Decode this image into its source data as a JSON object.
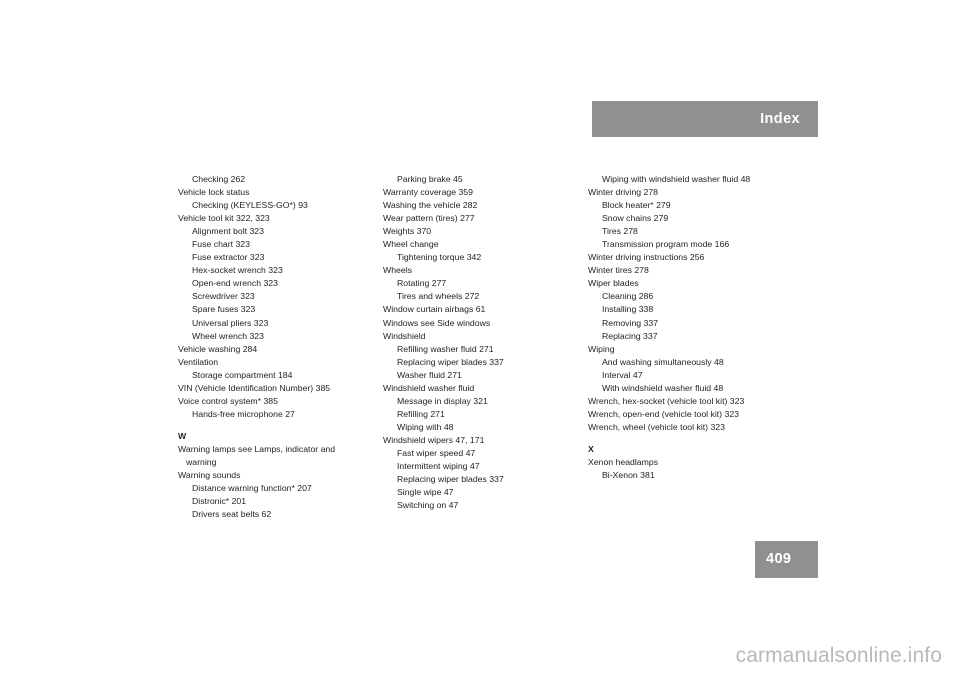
{
  "header": {
    "title": "Index"
  },
  "footer": {
    "page_number": "409",
    "watermark": "carmanualsonline.info"
  },
  "colors": {
    "band_gray": "#909090",
    "text": "#231f20",
    "watermark_gray": "#b9b9b9",
    "page_background": "#ffffff"
  },
  "columns": [
    {
      "id": "column-1",
      "entries": [
        {
          "text": "Checking 262",
          "level": 1
        },
        {
          "text": "Vehicle lock status",
          "level": 0
        },
        {
          "text": "Checking (KEYLESS-GO*) 93",
          "level": 1
        },
        {
          "text": "Vehicle tool kit 322, 323",
          "level": 0
        },
        {
          "text": "Alignment bolt 323",
          "level": 1
        },
        {
          "text": "Fuse chart 323",
          "level": 1
        },
        {
          "text": "Fuse extractor 323",
          "level": 1
        },
        {
          "text": "Hex-socket wrench 323",
          "level": 1
        },
        {
          "text": "Open-end wrench 323",
          "level": 1
        },
        {
          "text": "Screwdriver 323",
          "level": 1
        },
        {
          "text": "Spare fuses 323",
          "level": 1
        },
        {
          "text": "Universal pliers 323",
          "level": 1
        },
        {
          "text": "Wheel wrench 323",
          "level": 1
        },
        {
          "text": "Vehicle washing 284",
          "level": 0
        },
        {
          "text": "Ventilation",
          "level": 0
        },
        {
          "text": "Storage compartment 184",
          "level": 1
        },
        {
          "text": "VIN (Vehicle Identification Number) 385",
          "level": 0
        },
        {
          "text": "Voice control system* 385",
          "level": 0
        },
        {
          "text": "Hands-free microphone 27",
          "level": 1
        },
        {
          "text": "W",
          "level": "heading"
        },
        {
          "text": "Warning lamps see Lamps, indicator and",
          "level": 0
        },
        {
          "text": "warning",
          "level": "cont"
        },
        {
          "text": "Warning sounds",
          "level": 0
        },
        {
          "text": "Distance warning function* 207",
          "level": 1
        },
        {
          "text": "Distronic* 201",
          "level": 1
        },
        {
          "text": "Drivers seat belts 62",
          "level": 1
        }
      ]
    },
    {
      "id": "column-2",
      "entries": [
        {
          "text": "Parking brake 45",
          "level": 1
        },
        {
          "text": "Warranty coverage 359",
          "level": 0
        },
        {
          "text": "Washing the vehicle 282",
          "level": 0
        },
        {
          "text": "Wear pattern (tires) 277",
          "level": 0
        },
        {
          "text": "Weights 370",
          "level": 0
        },
        {
          "text": "Wheel change",
          "level": 0
        },
        {
          "text": "Tightening torque 342",
          "level": 1
        },
        {
          "text": "Wheels",
          "level": 0
        },
        {
          "text": "Rotating 277",
          "level": 1
        },
        {
          "text": "Tires and wheels 272",
          "level": 1
        },
        {
          "text": "Window curtain airbags 61",
          "level": 0
        },
        {
          "text": "Windows see Side windows",
          "level": 0
        },
        {
          "text": "Windshield",
          "level": 0
        },
        {
          "text": "Refilling washer fluid 271",
          "level": 1
        },
        {
          "text": "Replacing wiper blades 337",
          "level": 1
        },
        {
          "text": "Washer fluid 271",
          "level": 1
        },
        {
          "text": "Windshield washer fluid",
          "level": 0
        },
        {
          "text": "Message in display 321",
          "level": 1
        },
        {
          "text": "Refilling 271",
          "level": 1
        },
        {
          "text": "Wiping with 48",
          "level": 1
        },
        {
          "text": "Windshield wipers 47, 171",
          "level": 0
        },
        {
          "text": "Fast wiper speed 47",
          "level": 1
        },
        {
          "text": "Intermittent wiping 47",
          "level": 1
        },
        {
          "text": "Replacing wiper blades 337",
          "level": 1
        },
        {
          "text": "Single wipe 47",
          "level": 1
        },
        {
          "text": "Switching on 47",
          "level": 1
        }
      ]
    },
    {
      "id": "column-3",
      "entries": [
        {
          "text": "Wiping with windshield washer fluid 48",
          "level": 1
        },
        {
          "text": "Winter driving 278",
          "level": 0
        },
        {
          "text": "Block heater* 279",
          "level": 1
        },
        {
          "text": "Snow chains 279",
          "level": 1
        },
        {
          "text": "Tires 278",
          "level": 1
        },
        {
          "text": "Transmission program mode 166",
          "level": 1
        },
        {
          "text": "Winter driving instructions 256",
          "level": 0
        },
        {
          "text": "Winter tires 278",
          "level": 0
        },
        {
          "text": "Wiper blades",
          "level": 0
        },
        {
          "text": "Cleaning 286",
          "level": 1
        },
        {
          "text": "Installing 338",
          "level": 1
        },
        {
          "text": "Removing 337",
          "level": 1
        },
        {
          "text": "Replacing 337",
          "level": 1
        },
        {
          "text": "Wiping",
          "level": 0
        },
        {
          "text": "And washing simultaneously 48",
          "level": 1
        },
        {
          "text": "Interval 47",
          "level": 1
        },
        {
          "text": "With windshield washer fluid 48",
          "level": 1
        },
        {
          "text": "Wrench, hex-socket (vehicle tool kit) 323",
          "level": 0
        },
        {
          "text": "Wrench, open-end (vehicle tool kit) 323",
          "level": 0
        },
        {
          "text": "Wrench, wheel (vehicle tool kit) 323",
          "level": 0
        },
        {
          "text": "X",
          "level": "heading"
        },
        {
          "text": "Xenon headlamps",
          "level": 0
        },
        {
          "text": "Bi-Xenon 381",
          "level": 1
        }
      ]
    }
  ]
}
